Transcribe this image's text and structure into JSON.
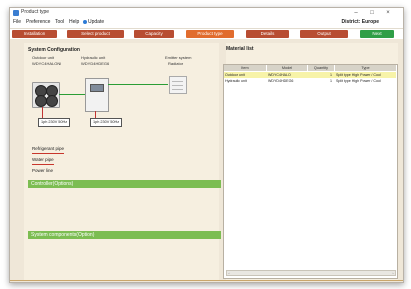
{
  "window": {
    "title": "Product type",
    "controls": {
      "minimize": "–",
      "maximize": "□",
      "close": "×"
    }
  },
  "menu": {
    "items": [
      "File",
      "Preference",
      "Tool",
      "Help",
      "Update"
    ],
    "region_label": "District: Europe"
  },
  "toolbar": {
    "buttons": [
      {
        "label": "Installation",
        "color": "#b84d32"
      },
      {
        "label": "Select product",
        "color": "#b84d32"
      },
      {
        "label": "Capacity",
        "color": "#b84d32"
      },
      {
        "label": "Product type",
        "color": "#e16c2d"
      },
      {
        "label": "Details",
        "color": "#b84d32"
      },
      {
        "label": "Output",
        "color": "#b84d32"
      },
      {
        "label": "Next",
        "color": "#2f9e46"
      }
    ]
  },
  "left_panel": {
    "section_title": "System Configuration",
    "outdoor_unit": {
      "label": "Outdoor unit",
      "model": "WDYC4HALONl"
    },
    "hydraulic_unit": {
      "label": "Hydraulic unit",
      "model": "WDYD4HDEG6"
    },
    "emitter_system": {
      "label": "Emitter system",
      "type": "Radiator"
    },
    "power_labels": [
      "1ph 230V 50Hz",
      "1ph 230V 50Hz"
    ],
    "sub_tabs": [
      "Refrigerant pipe",
      "Water pipe",
      "Power line"
    ],
    "sections": [
      "Controller(Options)",
      "System components(Option)"
    ]
  },
  "right_panel": {
    "title": "Material list",
    "table": {
      "headers": [
        "Item",
        "Model",
        "Quantity",
        "Type"
      ],
      "rows": [
        [
          "Outdoor unit",
          "WDYC4HALO",
          "1",
          "Split type High Power / Cool"
        ],
        [
          "Hydraulic unit",
          "WDYD4HDEG6",
          "1",
          "Split type High Power / Cool"
        ]
      ]
    },
    "scroll": {
      "left": "‹",
      "right": "›"
    }
  }
}
